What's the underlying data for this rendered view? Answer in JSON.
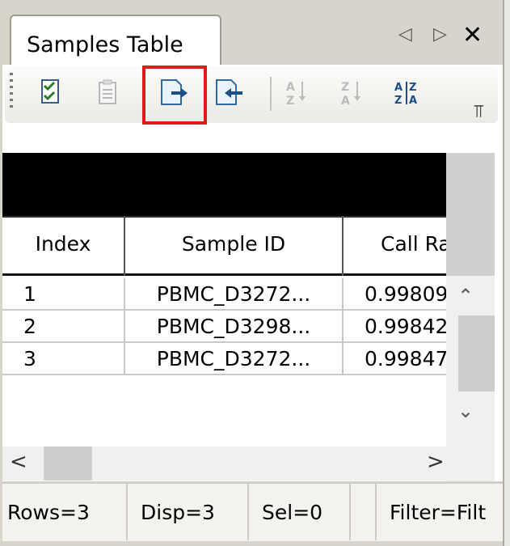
{
  "tab": {
    "title": "Samples Table",
    "prev_glyph": "◁",
    "next_glyph": "▷",
    "close_glyph": "✕"
  },
  "toolbar": {
    "buttons": [
      {
        "name": "check-list-icon"
      },
      {
        "name": "clipboard-list-icon"
      },
      {
        "name": "export-icon",
        "highlighted": true
      },
      {
        "name": "import-icon"
      },
      {
        "name": "sort-ascending-icon",
        "label_top": "A",
        "label_bottom": "Z"
      },
      {
        "name": "sort-descending-icon",
        "label_top": "Z",
        "label_bottom": "A"
      },
      {
        "name": "custom-sort-icon",
        "label_top": "AZ",
        "label_bottom": "ZA"
      }
    ],
    "overflow_glyph": "⫪",
    "highlight_color": "#e01b1b"
  },
  "table": {
    "columns": [
      "Index",
      "Sample ID",
      "Call Rate"
    ],
    "rows": [
      {
        "index": "1",
        "sample_id": "PBMC_D3272...",
        "call_rate": "0.99809"
      },
      {
        "index": "2",
        "sample_id": "PBMC_D3298...",
        "call_rate": "0.99842"
      },
      {
        "index": "3",
        "sample_id": "PBMC_D3272...",
        "call_rate": "0.99847"
      }
    ]
  },
  "scrollbars": {
    "up": "⌃",
    "down": "⌄",
    "left": "<",
    "right": ">"
  },
  "status": {
    "rows": "Rows=3",
    "disp": "Disp=3",
    "sel": "Sel=0",
    "filter": "Filter=Filt"
  }
}
